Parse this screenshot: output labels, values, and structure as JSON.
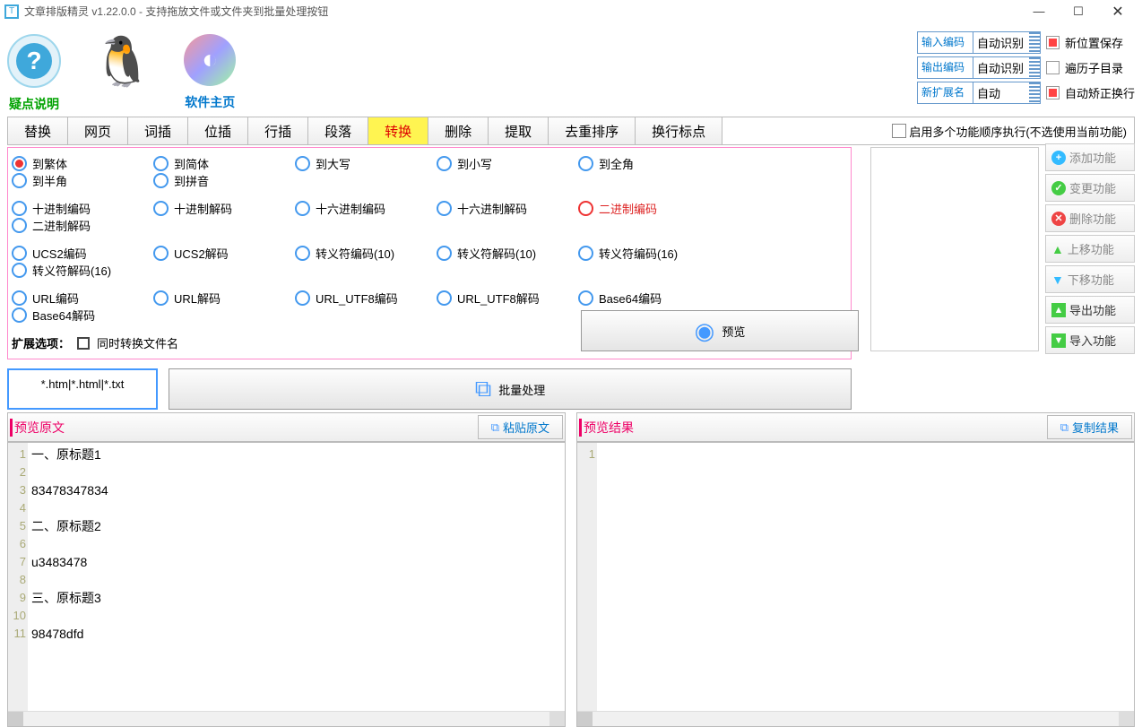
{
  "title": "文章排版精灵  v1.22.0.0 - 支持拖放文件或文件夹到批量处理按钮",
  "icons": {
    "help_label": "疑点说明",
    "qq_label": "",
    "home_label": "软件主页"
  },
  "settings": {
    "input_enc": {
      "label": "输入编码",
      "value": "自动识别"
    },
    "output_enc": {
      "label": "输出编码",
      "value": "自动识别"
    },
    "new_ext": {
      "label": "新扩展名",
      "value": "自动"
    },
    "chk1": "新位置保存",
    "chk2": "遍历子目录",
    "chk3": "自动矫正换行"
  },
  "tabs": [
    "替换",
    "网页",
    "词插",
    "位插",
    "行插",
    "段落",
    "转换",
    "删除",
    "提取",
    "去重排序",
    "换行标点"
  ],
  "active_tab": 6,
  "tab_right_chk": "启用多个功能顺序执行(不选使用当前功能)",
  "radios": [
    [
      "到繁体",
      "到简体",
      "到大写",
      "到小写",
      "到全角",
      "到半角",
      "到拼音"
    ],
    [
      "十进制编码",
      "十进制解码",
      "十六进制编码",
      "十六进制解码",
      "二进制编码",
      "二进制解码"
    ],
    [
      "UCS2编码",
      "UCS2解码",
      "转义符编码(10)",
      "转义符解码(10)",
      "转义符编码(16)",
      "转义符解码(16)"
    ],
    [
      "URL编码",
      "URL解码",
      "URL_UTF8编码",
      "URL_UTF8解码",
      "Base64编码",
      "Base64解码"
    ]
  ],
  "selected_radio": "到繁体",
  "red_radio": "二进制编码",
  "ext_label": "扩展选项：",
  "ext_chk": "同时转换文件名",
  "file_filter": "*.htm|*.html|*.txt",
  "batch_btn": "批量处理",
  "preview_btn": "预览",
  "right_btns": [
    "添加功能",
    "变更功能",
    "删除功能",
    "上移功能",
    "下移功能",
    "导出功能",
    "导入功能"
  ],
  "preview_src": "预览原文",
  "paste_btn": "粘贴原文",
  "preview_res": "预览结果",
  "copy_btn": "复制结果",
  "source_lines": [
    "一、原标题1",
    "",
    "83478347834",
    "",
    "二、原标题2",
    "",
    "u3483478",
    "",
    "三、原标题3",
    "",
    "98478dfd"
  ]
}
